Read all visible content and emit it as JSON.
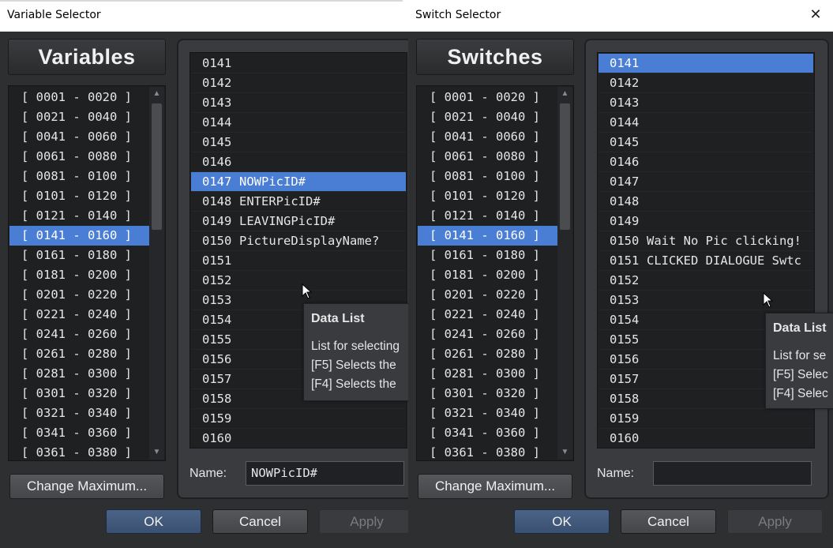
{
  "left": {
    "window_title": "Variable Selector",
    "heading": "Variables",
    "ranges": [
      "[ 0001 - 0020 ]",
      "[ 0021 - 0040 ]",
      "[ 0041 - 0060 ]",
      "[ 0061 - 0080 ]",
      "[ 0081 - 0100 ]",
      "[ 0101 - 0120 ]",
      "[ 0121 - 0140 ]",
      "[ 0141 - 0160 ]",
      "[ 0161 - 0180 ]",
      "[ 0181 - 0200 ]",
      "[ 0201 - 0220 ]",
      "[ 0221 - 0240 ]",
      "[ 0241 - 0260 ]",
      "[ 0261 - 0280 ]",
      "[ 0281 - 0300 ]",
      "[ 0301 - 0320 ]",
      "[ 0321 - 0340 ]",
      "[ 0341 - 0360 ]",
      "[ 0361 - 0380 ]"
    ],
    "selected_range": 7,
    "change_max_label": "Change Maximum...",
    "rows": [
      {
        "num": "0141",
        "name": ""
      },
      {
        "num": "0142",
        "name": ""
      },
      {
        "num": "0143",
        "name": ""
      },
      {
        "num": "0144",
        "name": ""
      },
      {
        "num": "0145",
        "name": ""
      },
      {
        "num": "0146",
        "name": ""
      },
      {
        "num": "0147",
        "name": "NOWPicID#"
      },
      {
        "num": "0148",
        "name": "ENTERPicID#"
      },
      {
        "num": "0149",
        "name": "LEAVINGPicID#"
      },
      {
        "num": "0150",
        "name": "PictureDisplayName?"
      },
      {
        "num": "0151",
        "name": ""
      },
      {
        "num": "0152",
        "name": ""
      },
      {
        "num": "0153",
        "name": ""
      },
      {
        "num": "0154",
        "name": ""
      },
      {
        "num": "0155",
        "name": ""
      },
      {
        "num": "0156",
        "name": ""
      },
      {
        "num": "0157",
        "name": ""
      },
      {
        "num": "0158",
        "name": ""
      },
      {
        "num": "0159",
        "name": ""
      },
      {
        "num": "0160",
        "name": ""
      }
    ],
    "selected_row": 6,
    "name_label": "Name:",
    "name_value": "NOWPicID#",
    "ok_label": "OK",
    "cancel_label": "Cancel",
    "apply_label": "Apply",
    "tooltip": {
      "title": "Data List",
      "line1": "List for selecting",
      "line2": "[F5] Selects the",
      "line3": "[F4] Selects the"
    }
  },
  "right": {
    "window_title": "Switch Selector",
    "heading": "Switches",
    "ranges": [
      "[ 0001 - 0020 ]",
      "[ 0021 - 0040 ]",
      "[ 0041 - 0060 ]",
      "[ 0061 - 0080 ]",
      "[ 0081 - 0100 ]",
      "[ 0101 - 0120 ]",
      "[ 0121 - 0140 ]",
      "[ 0141 - 0160 ]",
      "[ 0161 - 0180 ]",
      "[ 0181 - 0200 ]",
      "[ 0201 - 0220 ]",
      "[ 0221 - 0240 ]",
      "[ 0241 - 0260 ]",
      "[ 0261 - 0280 ]",
      "[ 0281 - 0300 ]",
      "[ 0301 - 0320 ]",
      "[ 0321 - 0340 ]",
      "[ 0341 - 0360 ]",
      "[ 0361 - 0380 ]"
    ],
    "selected_range": 7,
    "change_max_label": "Change Maximum...",
    "rows": [
      {
        "num": "0141",
        "name": ""
      },
      {
        "num": "0142",
        "name": ""
      },
      {
        "num": "0143",
        "name": ""
      },
      {
        "num": "0144",
        "name": ""
      },
      {
        "num": "0145",
        "name": ""
      },
      {
        "num": "0146",
        "name": ""
      },
      {
        "num": "0147",
        "name": ""
      },
      {
        "num": "0148",
        "name": ""
      },
      {
        "num": "0149",
        "name": ""
      },
      {
        "num": "0150",
        "name": "Wait No Pic clicking!"
      },
      {
        "num": "0151",
        "name": "CLICKED DIALOGUE Swtc"
      },
      {
        "num": "0152",
        "name": ""
      },
      {
        "num": "0153",
        "name": ""
      },
      {
        "num": "0154",
        "name": ""
      },
      {
        "num": "0155",
        "name": ""
      },
      {
        "num": "0156",
        "name": ""
      },
      {
        "num": "0157",
        "name": ""
      },
      {
        "num": "0158",
        "name": ""
      },
      {
        "num": "0159",
        "name": ""
      },
      {
        "num": "0160",
        "name": ""
      }
    ],
    "selected_row": 0,
    "name_label": "Name:",
    "name_value": "",
    "ok_label": "OK",
    "cancel_label": "Cancel",
    "apply_label": "Apply",
    "close_icon": "close-icon",
    "tooltip": {
      "title": "Data List",
      "line1": "List for se",
      "line2": "[F5] Selec",
      "line3": "[F4] Selec"
    }
  },
  "colors": {
    "selection": "#4a7dd4",
    "background": "#2e2f31",
    "list_bg": "#1f2022"
  }
}
